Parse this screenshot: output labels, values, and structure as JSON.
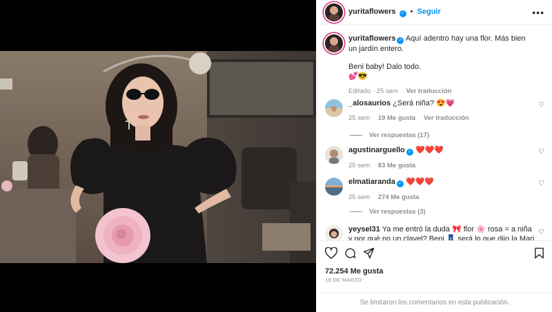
{
  "post": {
    "author": "yuritaflowers",
    "follow_label": "Seguir",
    "caption_user": "yuritaflowers",
    "caption_line1": "Aquí adentro hay una flor. Más bien un jardín entero.",
    "caption_line2": "Beni baby! Dalo todo.",
    "caption_emojis": "💕😎",
    "caption_meta_time": "Editado · 25 sem",
    "caption_meta_translate": "Ver traducción"
  },
  "comments": [
    {
      "user": "_alosaurios",
      "verified": false,
      "text": "¿Será niña? 😍💗",
      "time": "25 sem",
      "likes": "19 Me gusta",
      "translate": "Ver traducción",
      "replies": "Ver respuestas (17)"
    },
    {
      "user": "agustinarguello",
      "verified": true,
      "text": "❤️❤️❤️",
      "time": "25 sem",
      "likes": "83 Me gusta"
    },
    {
      "user": "elmatiaranda",
      "verified": true,
      "text": "❤️❤️❤️",
      "time": "25 sem",
      "likes": "274 Me gusta",
      "replies": "Ver respuestas (3)"
    },
    {
      "user": "yeysel31",
      "verified": false,
      "text": "Ya me entró la duda 🎀 flor 🌸 rosa = a niña y por qué no un clavel? Beni 👖 será lo que dijo la Mari Vidente 😂"
    }
  ],
  "footer": {
    "likes": "72.254 Me gusta",
    "date": "19 DE MARZO",
    "limited": "Se limitaron los comentarios en esta publicación."
  },
  "icons": {
    "like": "heart-icon",
    "comment": "comment-icon",
    "share": "share-icon",
    "save": "bookmark-icon",
    "more": "more-options-icon",
    "verified": "verified-badge-icon"
  },
  "colors": {
    "accent": "#0095f6",
    "muted": "#8e8e8e",
    "text": "#262626",
    "divider": "#efefef"
  }
}
